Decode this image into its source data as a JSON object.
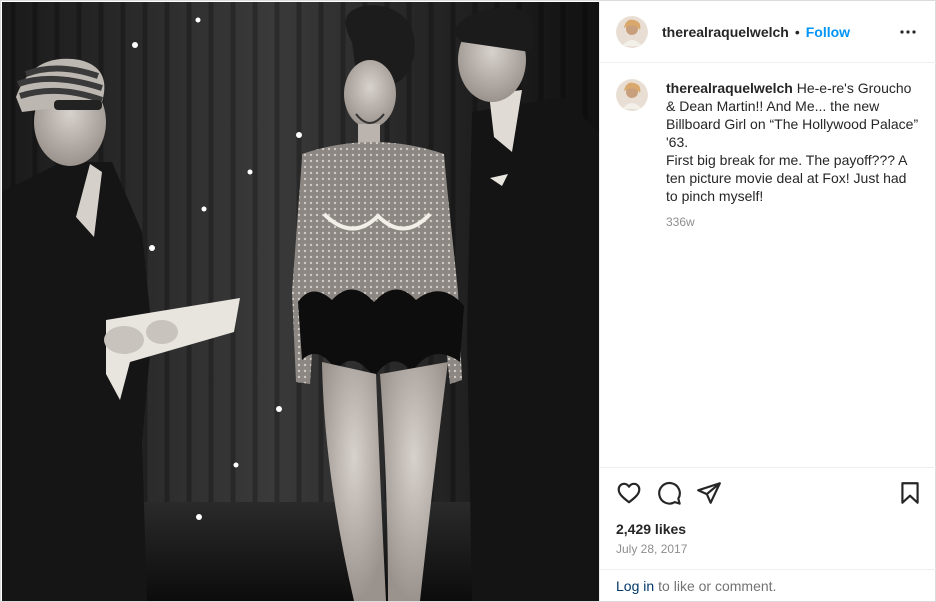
{
  "post": {
    "username": "therealraquelwelch",
    "follow_label": "Follow",
    "separator": "•",
    "caption_lines": "He-e-re's Groucho & Dean Martin!! And Me... the new Billboard Girl on “The Hollywood Palace” '63.\nFirst big break for me. The payoff??? A ten picture movie deal at Fox! Just had to pinch myself!",
    "caption_time": "336w",
    "likes": "2,429 likes",
    "date": "July 28, 2017",
    "login_link": "Log in",
    "login_suffix": "to like or comment."
  },
  "icons": {
    "more": "more-options-icon",
    "like": "heart-icon",
    "comment": "comment-icon",
    "share": "paper-plane-icon",
    "save": "bookmark-icon"
  },
  "colors": {
    "accent": "#0095f6",
    "link": "#00376b",
    "muted": "#8e8e8e",
    "text": "#262626",
    "border": "#efefef"
  }
}
